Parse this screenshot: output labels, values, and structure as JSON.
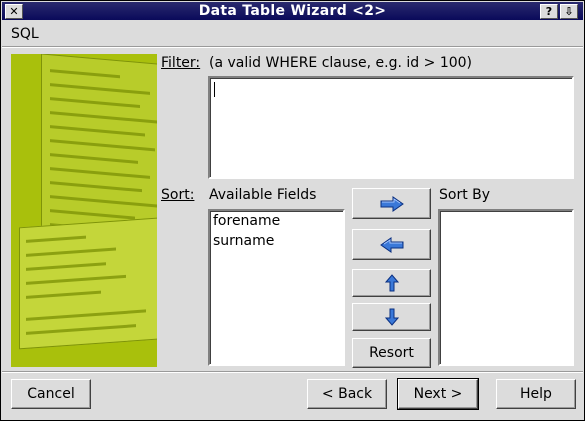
{
  "window": {
    "title": "Data Table Wizard <2>"
  },
  "titlebar": {
    "close_glyph": "✕",
    "help_glyph": "?",
    "menu_glyph": "⇩"
  },
  "header": {
    "label": "SQL"
  },
  "filter": {
    "label": "Filter:",
    "hint": "(a valid WHERE clause, e.g. id > 100)",
    "value": ""
  },
  "sort": {
    "label": "Sort:",
    "available_title": "Available Fields",
    "available_items": [
      "forename",
      "surname"
    ],
    "sortby_title": "Sort By",
    "sortby_items": [],
    "buttons": {
      "add_icon": "arrow-right-icon",
      "remove_icon": "arrow-left-icon",
      "up_icon": "arrow-up-icon",
      "down_icon": "arrow-down-icon",
      "resort_label": "Resort"
    }
  },
  "footer": {
    "cancel_label": "Cancel",
    "back_label": "< Back",
    "next_label": "Next >",
    "help_label": "Help"
  },
  "colors": {
    "title_bg": "#0a0a5a",
    "art_bg": "#a9c00c",
    "arrow_blue": "#3a78d8"
  }
}
